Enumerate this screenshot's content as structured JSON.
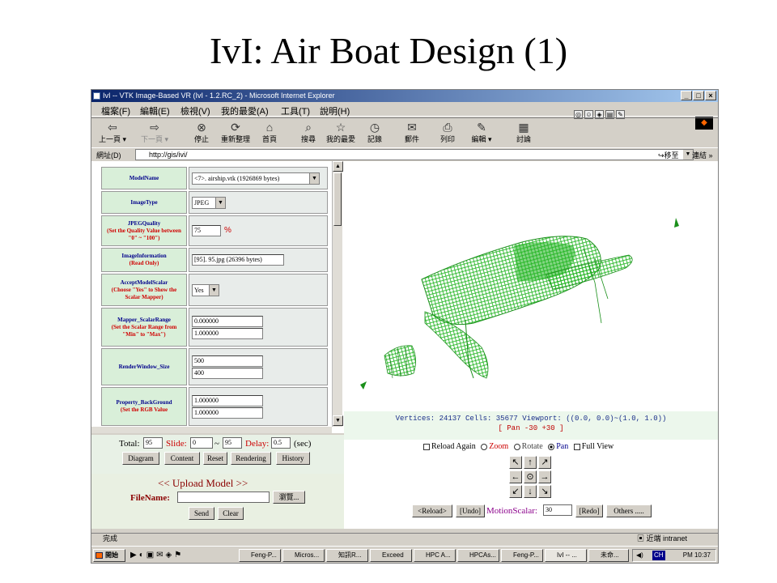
{
  "slide": {
    "title": "IvI: Air Boat Design (1)"
  },
  "window": {
    "title": "IvI -- VTK Image-Based VR (IvI - 1.2.RC_2) - Microsoft Internet Explorer"
  },
  "menu": [
    "檔案(F)",
    "編輯(E)",
    "檢視(V)",
    "我的最愛(A)",
    "工具(T)",
    "說明(H)"
  ],
  "toolbar": [
    "上一頁",
    "下一頁",
    "停止",
    "重新整理",
    "首頁",
    "搜尋",
    "我的最愛",
    "記錄",
    "郵件",
    "列印",
    "編輯",
    "討論"
  ],
  "address": {
    "label": "網址(D)",
    "url": "http://gis/ivi/",
    "go": "移至",
    "links": "連結 »"
  },
  "form": {
    "model_name": {
      "label": "ModelName",
      "value": "<7>. airship.vtk (1926869 bytes)"
    },
    "image_type": {
      "label": "ImageType",
      "value": "JPEG"
    },
    "jpeg_quality": {
      "label": "JPEGQuality",
      "sub": "(Set the Quality Value between \"0\" ~ \"100\")",
      "value": "75",
      "unit": "%"
    },
    "image_info": {
      "label": "ImageInformation",
      "sub": "(Read Only)",
      "value": "[95]. 95.jpg (26396 bytes)"
    },
    "accept_scalar": {
      "label": "AcceptModelScalar",
      "sub": "(Choose \"Yes\" to Show the Scalar Mapper)",
      "value": "Yes"
    },
    "scalar_range": {
      "label": "Mapper_ScalarRange",
      "sub": "(Set the Scalar Range from \"Min\" to \"Max\")",
      "min": "0.000000",
      "max": "1.000000"
    },
    "window_size": {
      "label": "RenderWindow_Size",
      "w": "500",
      "h": "400"
    },
    "background": {
      "label": "Property_BackGround",
      "sub": "(Set the RGB Value",
      "r": "1.000000",
      "g": "1.000000"
    }
  },
  "viewer": {
    "stats": "Vertices: 24137    Cells: 35677    Viewport: ((0.0, 0.0)~(1.0, 1.0))",
    "pan": "[ Pan -30 +30 ]"
  },
  "controls": {
    "total_label": "Total:",
    "total": "95",
    "slide_label": "Slide:",
    "slide": "0",
    "tilde": "~",
    "slide_end": "95",
    "delay_label": "Delay:",
    "delay": "0.5",
    "sec": "(sec)",
    "buttons": [
      "Diagram",
      "Content",
      "Reset",
      "Rendering",
      "History"
    ]
  },
  "upload": {
    "title": "<< Upload Model >>",
    "file_label": "FileName:",
    "browse": "瀏覽...",
    "send": "Send",
    "clear": "Clear"
  },
  "view_options": {
    "reload": "Reload Again",
    "zoom": "Zoom",
    "rotate": "Rotate",
    "pan": "Pan",
    "full": "Full View"
  },
  "nav": {
    "reload": "<Reload>",
    "undo": "[Undo]",
    "motion_label": "MotionScalar:",
    "motion": "30",
    "redo": "[Redo]",
    "others": "Others ....."
  },
  "status": {
    "text": "完成",
    "zone": "近端 intranet"
  },
  "taskbar": {
    "start": "開始",
    "tasks": [
      "Feng-P...",
      "Micros...",
      "知訊R...",
      "Exceed",
      "HPC A...",
      "HPCAs...",
      "Feng-P...",
      "IvI -- ...",
      "未命..."
    ],
    "clock": "PM 10:37",
    "lang": "CH"
  },
  "colors": {
    "mesh": "#1db31d",
    "label_bg": "#d9efd9",
    "panel_bg": "#ecf7ec",
    "accent_red": "#d00000",
    "accent_blue": "#00008b"
  }
}
